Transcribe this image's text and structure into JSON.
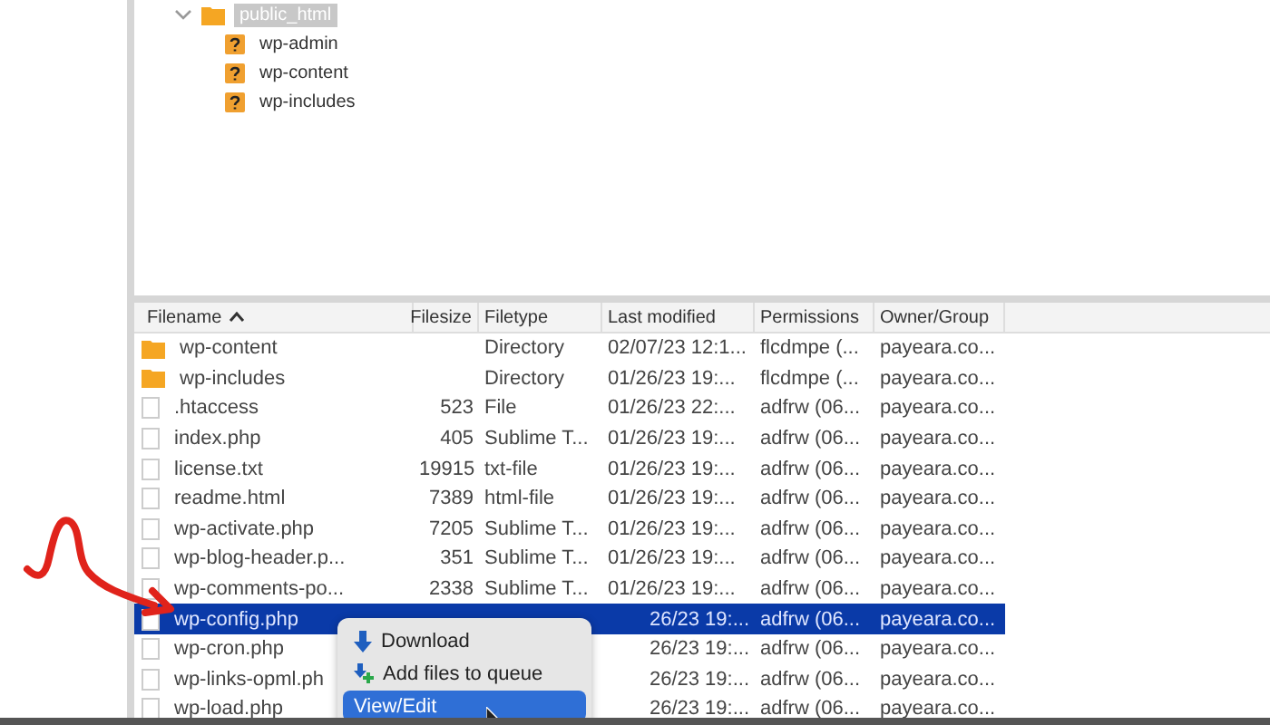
{
  "remote_tree": [
    {
      "name": "public_html",
      "kind": "folder",
      "selected": true,
      "expanded": true,
      "children": [
        {
          "name": "wp-admin",
          "kind": "unknown",
          "selected": false
        },
        {
          "name": "wp-content",
          "kind": "unknown",
          "selected": false
        },
        {
          "name": "wp-includes",
          "kind": "unknown",
          "selected": false
        }
      ]
    }
  ],
  "file_list": {
    "columns": [
      {
        "label": "Filename",
        "sorted": true
      },
      {
        "label": "Filesize",
        "sorted": false
      },
      {
        "label": "Filetype",
        "sorted": false
      },
      {
        "label": "Last modified",
        "sorted": false
      },
      {
        "label": "Permissions",
        "sorted": false
      },
      {
        "label": "Owner/Group",
        "sorted": false
      }
    ],
    "rows": [
      {
        "kind": "folder",
        "name": "wp-content",
        "size": "",
        "type": "Directory",
        "modified": "02/07/23 12:1...",
        "permissions": "flcdmpe (...",
        "owner": "payeara.co...",
        "selected": false
      },
      {
        "kind": "folder",
        "name": "wp-includes",
        "size": "",
        "type": "Directory",
        "modified": "01/26/23 19:...",
        "permissions": "flcdmpe (...",
        "owner": "payeara.co...",
        "selected": false
      },
      {
        "kind": "file",
        "name": ".htaccess",
        "size": "523",
        "type": "File",
        "modified": "01/26/23 22:...",
        "permissions": "adfrw (06...",
        "owner": "payeara.co...",
        "selected": false
      },
      {
        "kind": "file",
        "name": "index.php",
        "size": "405",
        "type": "Sublime T...",
        "modified": "01/26/23 19:...",
        "permissions": "adfrw (06...",
        "owner": "payeara.co...",
        "selected": false
      },
      {
        "kind": "file",
        "name": "license.txt",
        "size": "19915",
        "type": "txt-file",
        "modified": "01/26/23 19:...",
        "permissions": "adfrw (06...",
        "owner": "payeara.co...",
        "selected": false
      },
      {
        "kind": "file",
        "name": "readme.html",
        "size": "7389",
        "type": "html-file",
        "modified": "01/26/23 19:...",
        "permissions": "adfrw (06...",
        "owner": "payeara.co...",
        "selected": false
      },
      {
        "kind": "file",
        "name": "wp-activate.php",
        "size": "7205",
        "type": "Sublime T...",
        "modified": "01/26/23 19:...",
        "permissions": "adfrw (06...",
        "owner": "payeara.co...",
        "selected": false
      },
      {
        "kind": "file",
        "name": "wp-blog-header.p...",
        "size": "351",
        "type": "Sublime T...",
        "modified": "01/26/23 19:...",
        "permissions": "adfrw (06...",
        "owner": "payeara.co...",
        "selected": false
      },
      {
        "kind": "file",
        "name": "wp-comments-po...",
        "size": "2338",
        "type": "Sublime T...",
        "modified": "01/26/23 19:...",
        "permissions": "adfrw (06...",
        "owner": "payeara.co...",
        "selected": false
      },
      {
        "kind": "file",
        "name": "wp-config.php",
        "size": "",
        "type": "",
        "modified": "26/23 19:...",
        "permissions": "adfrw (06...",
        "owner": "payeara.co...",
        "selected": true
      },
      {
        "kind": "file",
        "name": "wp-cron.php",
        "size": "",
        "type": "",
        "modified": "26/23 19:...",
        "permissions": "adfrw (06...",
        "owner": "payeara.co...",
        "selected": false
      },
      {
        "kind": "file",
        "name": "wp-links-opml.ph",
        "size": "",
        "type": "",
        "modified": "26/23 19:...",
        "permissions": "adfrw (06...",
        "owner": "payeara.co...",
        "selected": false
      },
      {
        "kind": "file",
        "name": "wp-load.php",
        "size": "",
        "type": "",
        "modified": "26/23 19:...",
        "permissions": "adfrw (06...",
        "owner": "payeara.co...",
        "selected": false
      }
    ]
  },
  "context_menu": {
    "items": [
      {
        "kind": "download",
        "label": "Download",
        "selected": false
      },
      {
        "kind": "queue",
        "label": "Add files to queue",
        "selected": false
      },
      {
        "kind": "plain",
        "label": "View/Edit",
        "selected": true
      }
    ]
  }
}
